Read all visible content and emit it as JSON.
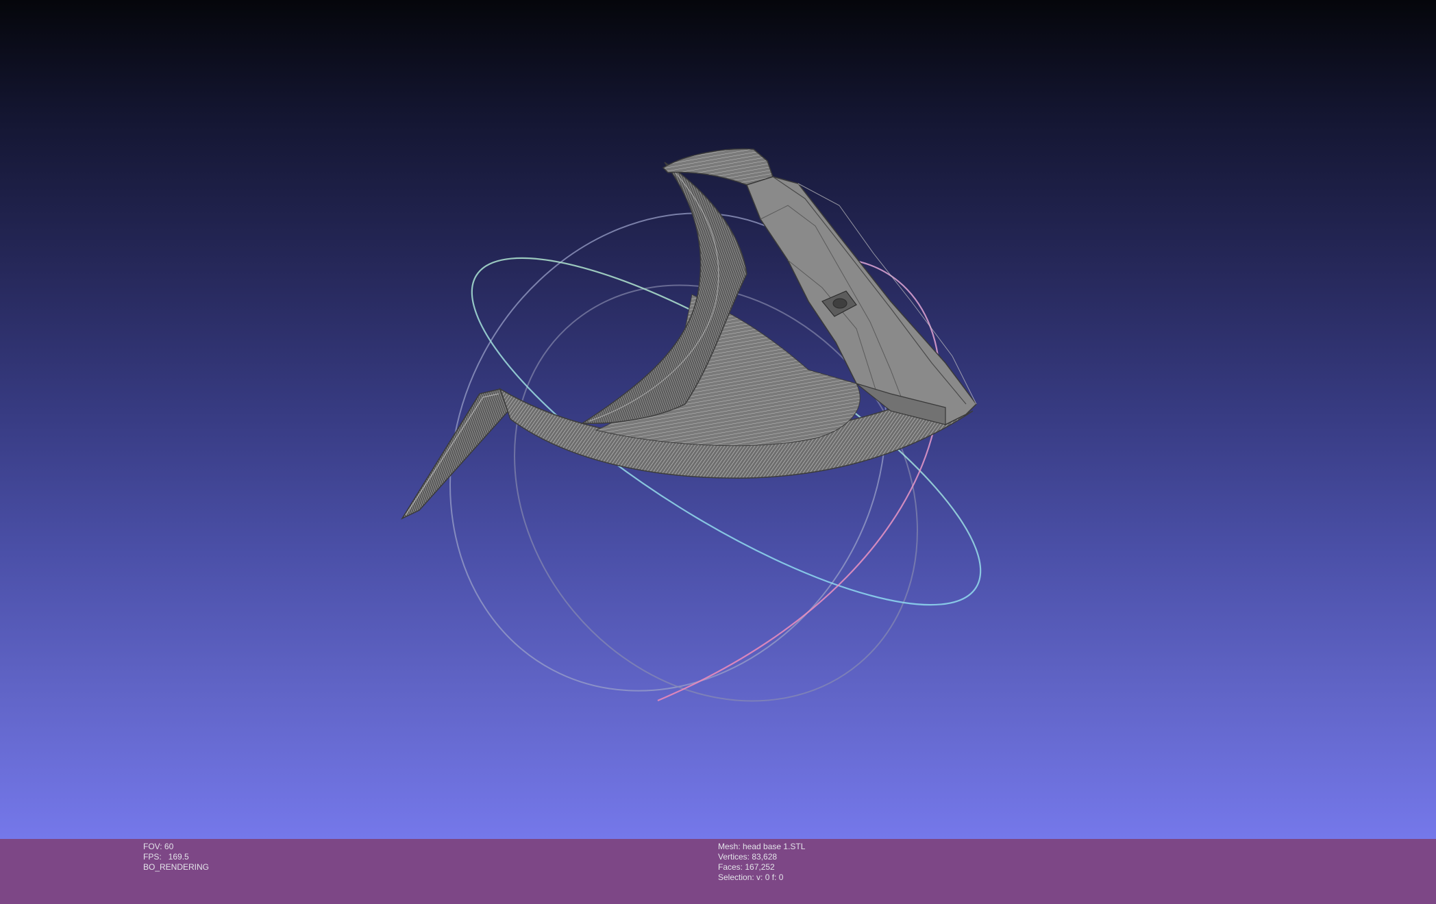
{
  "viewer": {
    "background_top_color": "#05060b",
    "background_bottom_color": "#7578ea",
    "info_bar_color": "#7d4786",
    "mesh_color": "#8e8e8e",
    "trackball_colors": [
      "#9aa0c8",
      "#c8f0c8",
      "#f0a8d0"
    ]
  },
  "info_left": {
    "fov": "FOV: 60",
    "fps": "FPS:   169.5",
    "render_mode": "BO_RENDERING"
  },
  "info_right": {
    "mesh": "Mesh: head base 1.STL",
    "vertices": "Vertices: 83,628",
    "faces": "Faces: 167,252",
    "selection": "Selection: v: 0 f: 0"
  }
}
